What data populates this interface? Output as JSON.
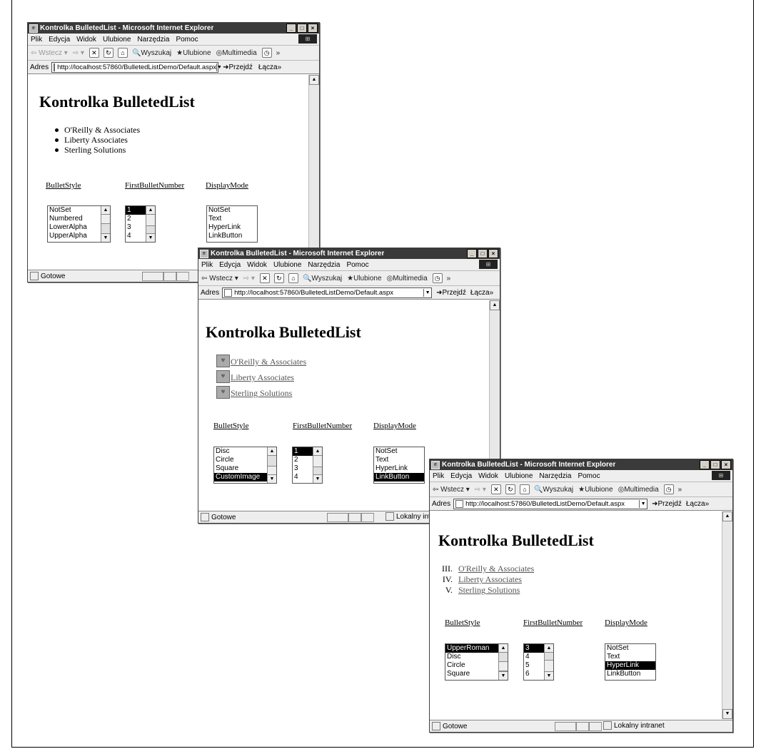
{
  "browser": {
    "title": "Kontrolka BulletedList - Microsoft Internet Explorer",
    "menu": [
      "Plik",
      "Edycja",
      "Widok",
      "Ulubione",
      "Narzędzia",
      "Pomoc"
    ],
    "toolbar": {
      "back": "Wstecz",
      "search": "Wyszukaj",
      "favorites": "Ulubione",
      "media": "Multimedia"
    },
    "address_label": "Adres",
    "url": "http://localhost:57860/BulletedListDemo/Default.aspx",
    "go": "Przejdź",
    "links": "Łącza",
    "status": "Gotowe",
    "zone": "Lokalny intranet",
    "window_buttons": [
      "_",
      "□",
      "×"
    ]
  },
  "page": {
    "heading": "Kontrolka BulletedList",
    "label_bulletstyle": "BulletStyle",
    "label_firstnumber": "FirstBulletNumber",
    "label_displaymode": "DisplayMode",
    "items": [
      "O'Reilly & Associates",
      "Liberty Associates",
      "Sterling Solutions"
    ]
  },
  "windows": [
    {
      "bulletstyle_rows": [
        "NotSet",
        "Numbered",
        "LowerAlpha",
        "UpperAlpha"
      ],
      "bulletstyle_selected": -1,
      "number_rows": [
        "1",
        "2",
        "3",
        "4"
      ],
      "number_selected": 0,
      "displaymode_rows": [
        "NotSet",
        "Text",
        "HyperLink",
        "LinkButton"
      ],
      "displaymode_selected": -1
    },
    {
      "bulletstyle_rows": [
        "Disc",
        "Circle",
        "Square",
        "CustomImage"
      ],
      "bulletstyle_selected": 3,
      "number_rows": [
        "1",
        "2",
        "3",
        "4"
      ],
      "number_selected": 0,
      "displaymode_rows": [
        "NotSet",
        "Text",
        "HyperLink",
        "LinkButton"
      ],
      "displaymode_selected": 3
    },
    {
      "roman": [
        "III.",
        "IV.",
        "V."
      ],
      "bulletstyle_rows": [
        "UpperRoman",
        "Disc",
        "Circle",
        "Square"
      ],
      "bulletstyle_selected": 0,
      "number_rows": [
        "3",
        "4",
        "5",
        "6"
      ],
      "number_selected": 0,
      "displaymode_rows": [
        "NotSet",
        "Text",
        "HyperLink",
        "LinkButton"
      ],
      "displaymode_selected": 2
    }
  ]
}
